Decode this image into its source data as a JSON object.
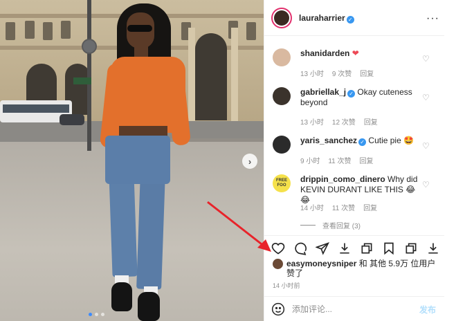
{
  "post": {
    "author": {
      "username": "lauraharrier",
      "verified": true,
      "avatar_icon": "avatar-icon"
    },
    "more_icon": "more-horizontal-icon",
    "carousel": {
      "slides": 3,
      "current": 1,
      "next_icon": "chevron-right-icon"
    }
  },
  "comments": [
    {
      "username": "shanidarden",
      "verified": false,
      "text": "",
      "emoji": "❤",
      "time": "13 小时",
      "likes": "9 次赞",
      "reply": "回复",
      "avatar_color": "#d9b9a0"
    },
    {
      "username": "gabriellak_j",
      "verified": true,
      "text": "Okay cuteness beyond",
      "emoji": "",
      "time": "13 小时",
      "likes": "12 次赞",
      "reply": "回复",
      "avatar_color": "#3b332c"
    },
    {
      "username": "yaris_sanchez",
      "verified": true,
      "text": "Cutie pie",
      "emoji": "🤩",
      "time": "9 小时",
      "likes": "11 次赞",
      "reply": "回复",
      "avatar_color": "#2b2b2b"
    },
    {
      "username": "drippin_como_dinero",
      "verified": false,
      "text": "Why did KEVIN DURANT LIKE THIS",
      "emoji": "😂😂",
      "time": "14 小时",
      "likes": "11 次赞",
      "reply": "回复",
      "avatar_label": "FREE FOO"
    }
  ],
  "view_replies": "查看回复 (3)",
  "actions": [
    "heart-icon",
    "comment-icon",
    "share-icon",
    "download-icon",
    "copy-icon",
    "bookmark-icon",
    "copy-icon",
    "download-icon"
  ],
  "likes": {
    "liker": "easymoneysniper",
    "text": " 和 其他 5.9万 位用户 赞了"
  },
  "timestamp": "14 小时前",
  "comment_input": {
    "placeholder": "添加评论...",
    "post_label": "发布"
  },
  "colors": {
    "accent": "#3897f0",
    "heart_red": "#ed4956",
    "muted": "#8e8e8e",
    "arrow_red": "#e8232a"
  }
}
